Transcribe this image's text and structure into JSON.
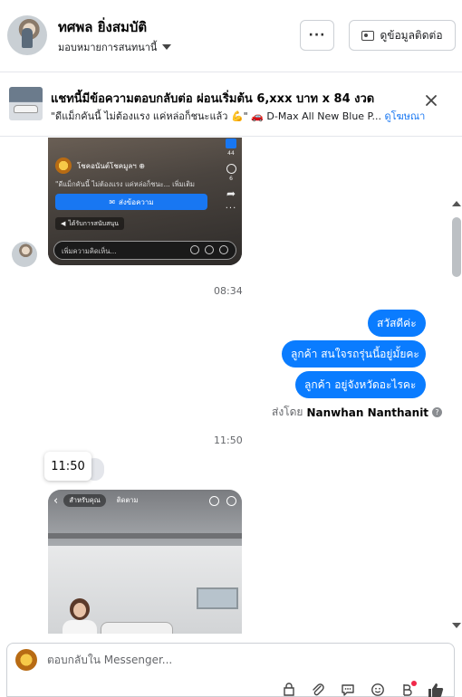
{
  "header": {
    "name": "ทศพล ยิ่งสมบัติ",
    "assignment": "มอบหมายการสนทนานี้",
    "more_label": "···",
    "contact_button": "ดูข้อมูลติดต่อ"
  },
  "ad_banner": {
    "title": "แชทนี้มีข้อความตอบกลับต่อ ผ่อนเริ่มต้น 6,xxx บาท x 84 งวด",
    "description": "\"ดีแม็กคันนี้ ไม่ต้องแรง แค่หล่อก็ชนะแล้ว 💪\" 🚗 D-Max All New Blue P...",
    "link": "ดูโฆษณา",
    "close_label": "×"
  },
  "thread": {
    "shared_reel_1": {
      "page_name": "โชคอนันต์โชคมูลฯ ⊕",
      "caption": "\"ดีแม็กคันนี้ ไม่ต้องแรง แค่หล่อก็ชนะ... เพิ่มเติม",
      "cta": "ส่งข้อความ",
      "ad_label": "ได้รับการสนับสนุน",
      "like_count": "44",
      "comment_count": "6",
      "comment_placeholder": "เพิ่มความคิดเห็น..."
    },
    "time_1": "08:34",
    "outgoing": [
      "สวัสดีค่ะ",
      "ลูกค้า สนใจรถรุ่นนี้อยู่มั้ยคะ",
      "ลูกค้า อยู่จังหวัดอะไรคะ"
    ],
    "sent_by_prefix": "ส่งโดย",
    "sent_by_name": "Nanwhan Nanthanit",
    "info_icon_label": "?",
    "time_2": "11:50",
    "tooltip_time": "11:50",
    "shared_reel_2": {
      "tab_1": "สำหรับคุณ",
      "tab_2": "ติดตาม"
    }
  },
  "composer": {
    "placeholder": "ตอบกลับใน Messenger..."
  },
  "colors": {
    "accent": "#1877f2",
    "bubble": "#0a7cff",
    "notification_dot": "#f02849"
  }
}
